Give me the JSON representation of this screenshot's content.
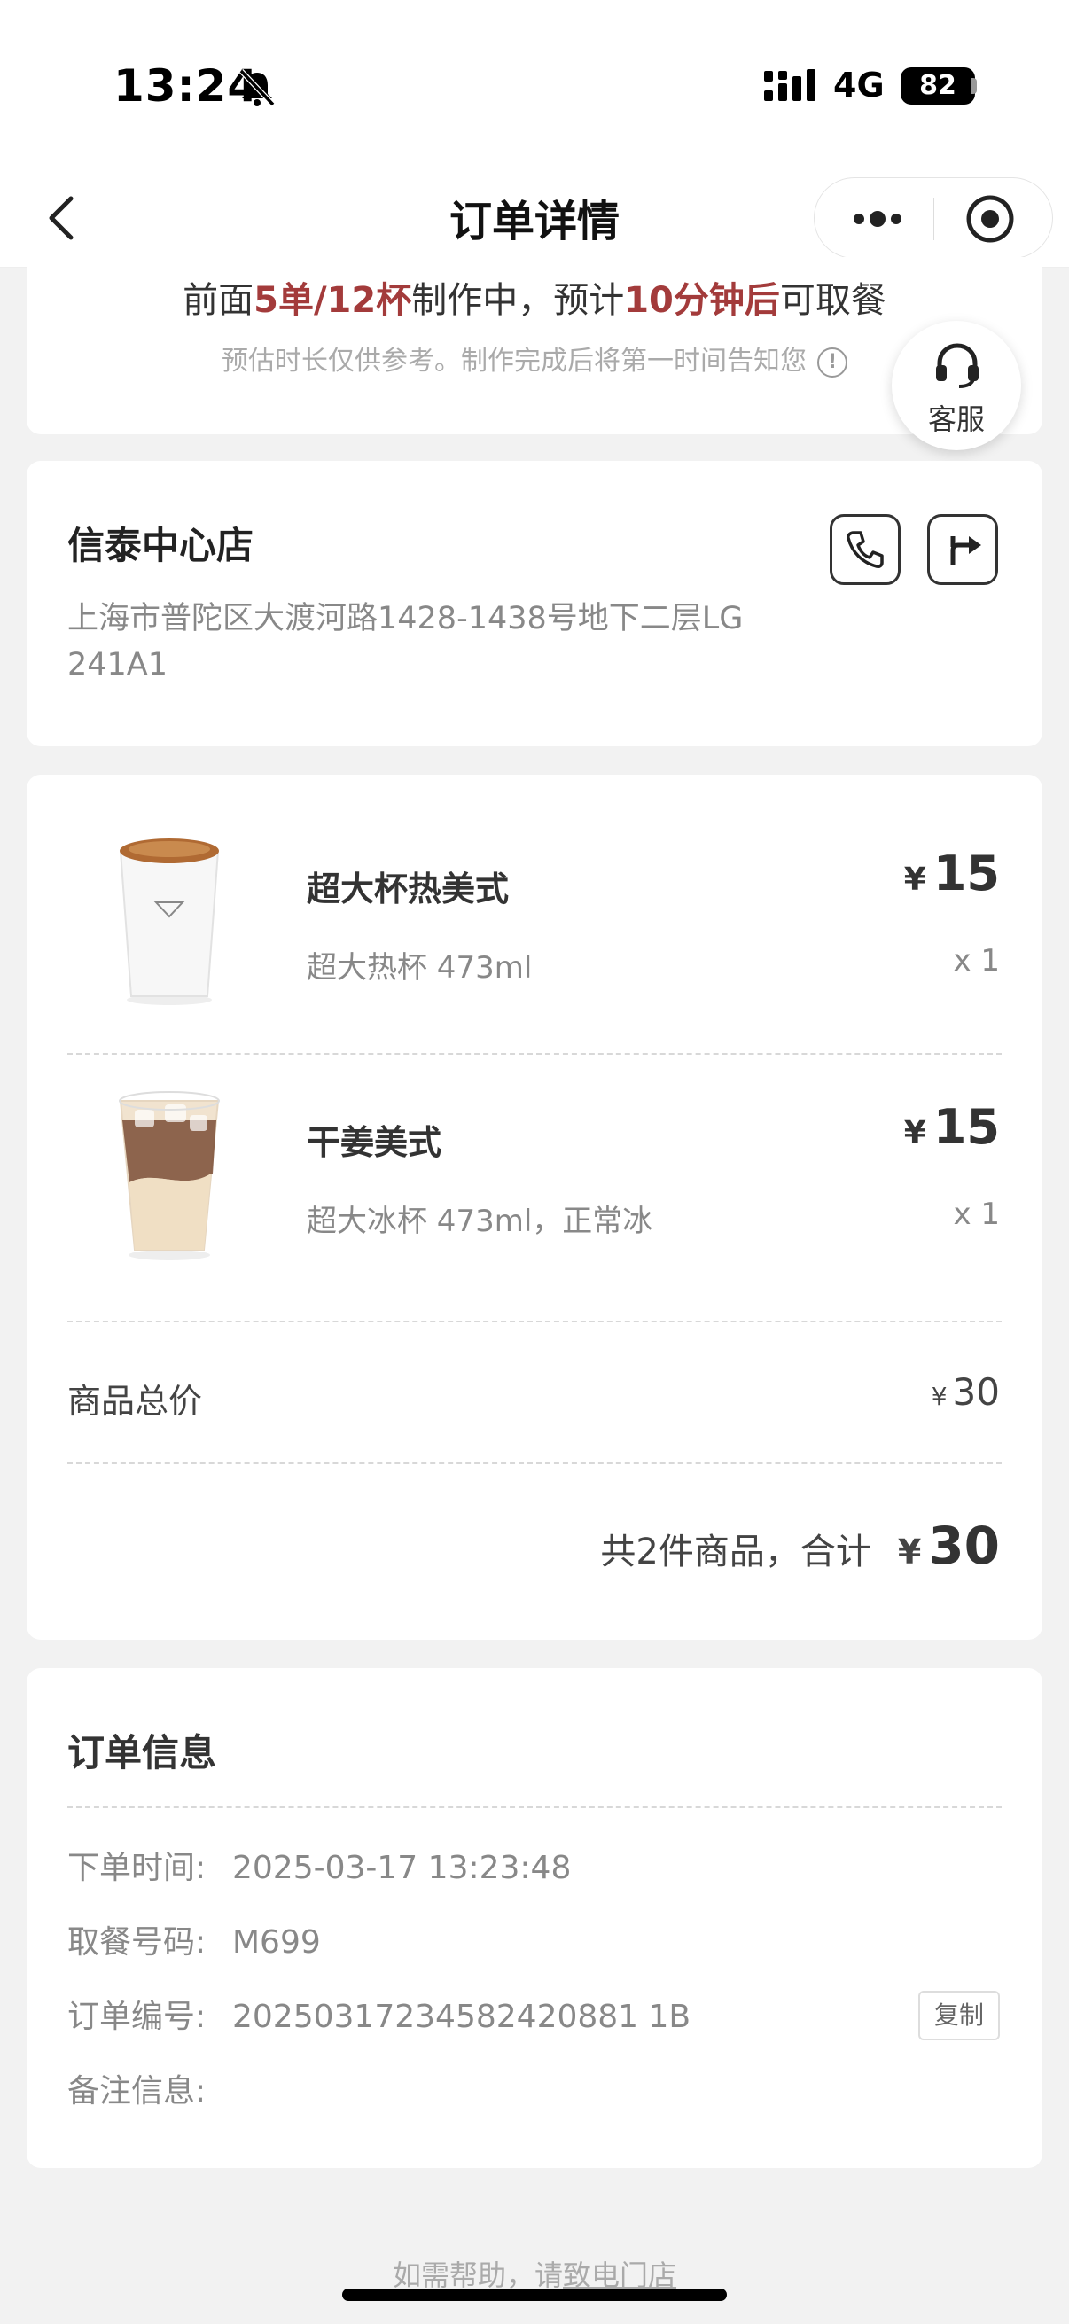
{
  "status_bar": {
    "time": "13:24",
    "network": "4G",
    "battery": "82"
  },
  "nav": {
    "title": "订单详情"
  },
  "queue": {
    "prefix": "前面",
    "orders_cups": "5单/12杯",
    "middle": "制作中，预计",
    "eta": "10分钟后",
    "suffix": "可取餐",
    "hint": "预估时长仅供参考。制作完成后将第一时间告知您",
    "hint_icon": "!"
  },
  "service": {
    "label": "客服"
  },
  "store": {
    "name": "信泰中心店",
    "address_line1": "上海市普陀区大渡河路1428-1438号地下二层LG",
    "address_line2": "241A1"
  },
  "items": [
    {
      "name": "超大杯热美式",
      "spec": "超大热杯 473ml",
      "price": "15",
      "qty": "x 1"
    },
    {
      "name": "干姜美式",
      "spec": "超大冰杯 473ml，正常冰",
      "price": "15",
      "qty": "x 1"
    }
  ],
  "currency": "¥",
  "subtotal": {
    "label": "商品总价",
    "value": "30"
  },
  "total": {
    "label": "共2件商品，合计",
    "value": "30"
  },
  "order_info": {
    "title": "订单信息",
    "rows": [
      {
        "label": "下单时间:",
        "value": "2025-03-17 13:23:48"
      },
      {
        "label": "取餐号码:",
        "value": "M699"
      },
      {
        "label": "订单编号:",
        "value": "20250317234582420881 1B"
      },
      {
        "label": "备注信息:",
        "value": ""
      }
    ],
    "copy_label": "复制"
  },
  "footer": {
    "help_text": "如需帮助，请",
    "link_text": "致电门店"
  },
  "colors": {
    "accent_red": "#a33b3b",
    "background": "#f2f2f2"
  }
}
